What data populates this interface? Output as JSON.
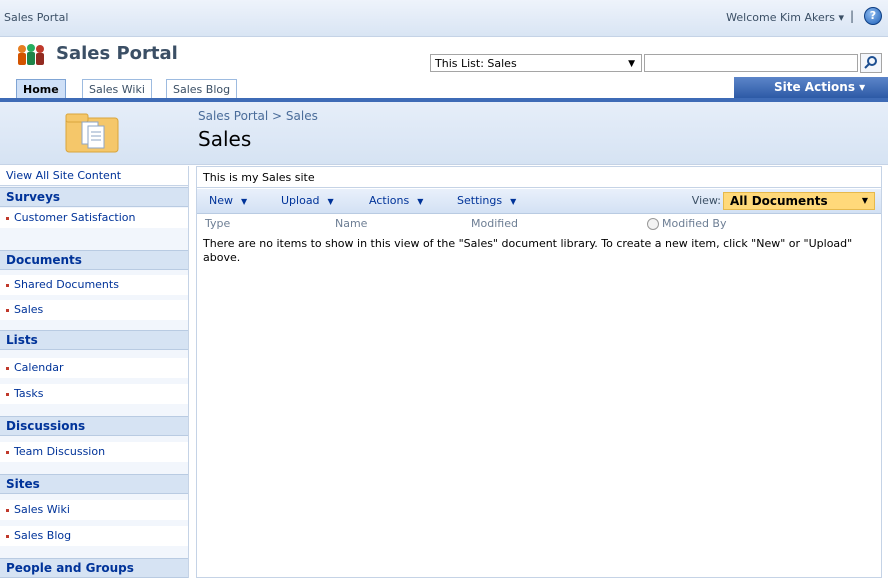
{
  "topbar": {
    "site_title": "Sales Portal",
    "welcome": "Welcome Kim Akers ▾",
    "separator": "|",
    "help_icon": "help-icon"
  },
  "header": {
    "portal_title": "Sales Portal",
    "search_scope": "This List: Sales",
    "search_placeholder": "",
    "search_icon": "search-icon"
  },
  "tabs": [
    {
      "label": "Home",
      "selected": true
    },
    {
      "label": "Sales Wiki",
      "selected": false
    },
    {
      "label": "Sales Blog",
      "selected": false
    }
  ],
  "site_actions": "Site Actions ▾",
  "page": {
    "breadcrumb": "Sales Portal > Sales",
    "title": "Sales"
  },
  "leftnav": {
    "view_all": "View All Site Content",
    "sections": [
      {
        "heading": "Surveys",
        "items": [
          "Customer Satisfaction"
        ]
      },
      {
        "heading": "Documents",
        "items": [
          "Shared Documents",
          "Sales"
        ]
      },
      {
        "heading": "Lists",
        "items": [
          "Calendar",
          "Tasks"
        ]
      },
      {
        "heading": "Discussions",
        "items": [
          "Team Discussion"
        ]
      },
      {
        "heading": "Sites",
        "items": [
          "Sales Wiki",
          "Sales Blog"
        ]
      },
      {
        "heading": "People and Groups",
        "items": []
      }
    ]
  },
  "main": {
    "description": "This is my Sales site",
    "toolbar": {
      "new": "New",
      "upload": "Upload",
      "actions": "Actions",
      "settings": "Settings",
      "view_label": "View:",
      "view_value": "All Documents"
    },
    "columns": [
      "Type",
      "Name",
      "Modified",
      "Modified By"
    ],
    "empty_message": "There are no items to show in this view of the \"Sales\" document library. To create a new item, click \"New\" or \"Upload\" above."
  },
  "colors": {
    "accent": "#3e6bb6",
    "nav_heading_bg": "#d6e3f3",
    "view_select_bg": "#ffd97a"
  }
}
